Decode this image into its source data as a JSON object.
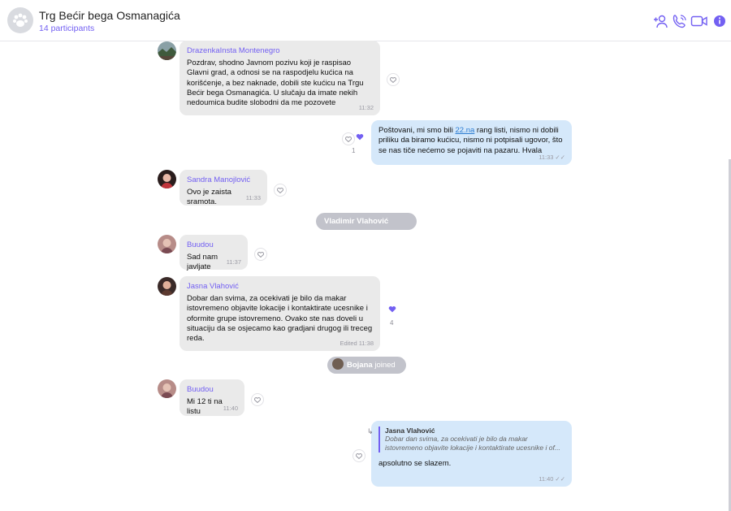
{
  "header": {
    "title": "Trg Bećir bega Osmanagića",
    "participants": "14 participants",
    "icons": [
      "add-participant-icon",
      "call-icon",
      "video-icon",
      "info-icon"
    ],
    "accent": "#7360f2"
  },
  "messages": [
    {
      "sender": "DrazenkaInsta Montenegro",
      "text": "Pozdrav, shodno Javnom pozivu koji je raspisao Glavni grad, a odnosi se na raspodjelu kućica na korišćenje, a bez naknade, dobili ste kućicu na Trgu Bećir bega Osmanagića. U slučaju da imate nekih nedoumica budite slobodni da me pozovete",
      "time": "11:32"
    },
    {
      "text_before_link": "Poštovani, mi smo bili ",
      "link": "22.na",
      "text_after_link": " rang listi, nismo ni dobili priliku da biramo kućicu, nismo ni potpisali ugovor, što se nas tiče nećemo se pojaviti na pazaru. Hvala",
      "time": "11:33",
      "likes": "1"
    },
    {
      "sender": "Sandra Manojlović",
      "text": "Ovo je zaista sramota.",
      "time": "11:33"
    },
    {
      "system_name": "Vladimir Vlahović",
      "system_action": "joined"
    },
    {
      "sender": "Buudou",
      "text": "Sad nam javljate",
      "time": "11:37"
    },
    {
      "sender": "Jasna Vlahović",
      "text": "Dobar dan svima, za ocekivati je bilo da makar istovremeno objavite lokacije i kontaktirate ucesnike i oformite grupe istovremeno. Ovako ste nas doveli u situaciju da se osjecamo kao gradjani drugog ili treceg reda.",
      "time": "Edited 11:38",
      "likes": "4"
    },
    {
      "system_name": "Bojana",
      "system_action": "joined"
    },
    {
      "sender": "Buudou",
      "text": "Mi 12 ti na listu",
      "time": "11:40"
    },
    {
      "quote_name": "Jasna Vlahović",
      "quote_text": "Dobar dan svima, za ocekivati je bilo da makar istovremeno objavite lokacije i kontaktirate ucesnike i of...",
      "text": "apsolutno se slazem.",
      "time": "11:40"
    }
  ]
}
